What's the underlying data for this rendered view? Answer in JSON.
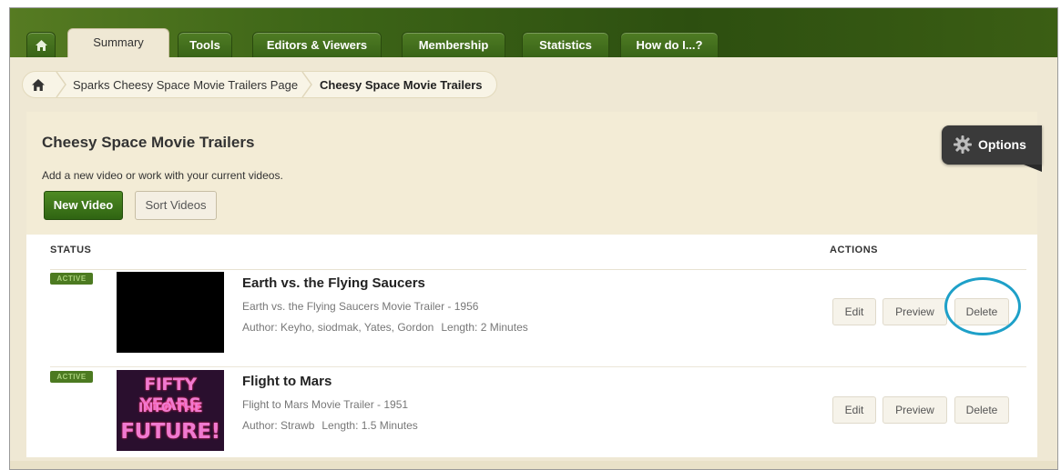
{
  "tabs": [
    {
      "label": "",
      "icon": "home-icon"
    },
    {
      "label": "Summary",
      "active": true
    },
    {
      "label": "Tools"
    },
    {
      "label": "Editors & Viewers"
    },
    {
      "label": "Membership"
    },
    {
      "label": "Statistics"
    },
    {
      "label": "How do I...?"
    }
  ],
  "breadcrumb": {
    "home_icon": "home-icon",
    "items": [
      "Sparks Cheesy Space Movie Trailers Page",
      "Cheesy Space Movie Trailers"
    ]
  },
  "page": {
    "title": "Cheesy Space Movie Trailers",
    "subtitle": "Add a new video or work with your current videos.",
    "new_video_label": "New Video",
    "sort_videos_label": "Sort Videos"
  },
  "options": {
    "label": "Options",
    "icon": "gear-icon"
  },
  "table": {
    "status_header": "STATUS",
    "actions_header": "ACTIONS",
    "videos": [
      {
        "status": "ACTIVE",
        "title": "Earth vs. the Flying Saucers",
        "description": "Earth vs. the Flying Saucers Movie Trailer - 1956",
        "author": "Author: Keyho, siodmak, Yates, Gordon",
        "length": "Length: 2 Minutes",
        "thumbnail": "black video thumbnail"
      },
      {
        "status": "ACTIVE",
        "title": "Flight to Mars",
        "description": "Flight to Mars Movie Trailer - 1951",
        "author": "Author: Strawb",
        "length": "Length: 1.5 Minutes",
        "thumbnail_text": [
          "FIFTY YEARS",
          "INTO THE",
          "FUTURE!"
        ]
      }
    ],
    "actions": {
      "edit": "Edit",
      "preview": "Preview",
      "delete": "Delete"
    }
  },
  "colors": {
    "tab_green": "#3d6517",
    "button_green": "#3c7618",
    "panel_beige": "#f3ecd6",
    "highlight_ring": "#1ea0c8"
  }
}
